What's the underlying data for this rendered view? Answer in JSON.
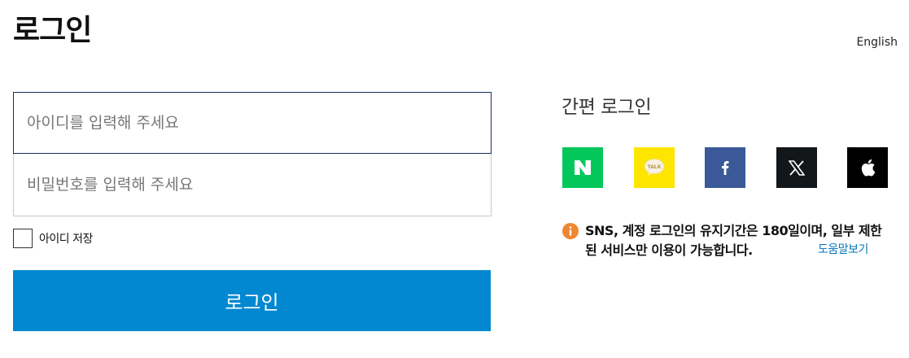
{
  "page": {
    "title": "로그인",
    "language_link": "English"
  },
  "form": {
    "id_placeholder": "아이디를 입력해 주세요",
    "password_placeholder": "비밀번호를 입력해 주세요",
    "save_id_label": "아이디 저장",
    "login_button": "로그인"
  },
  "sns": {
    "title": "간편 로그인",
    "providers": [
      {
        "name": "naver",
        "icon": "naver-icon",
        "color": "#03c75a"
      },
      {
        "name": "kakao",
        "icon": "kakao-talk-icon",
        "color": "#fee500"
      },
      {
        "name": "facebook",
        "icon": "facebook-icon",
        "color": "#3b5998"
      },
      {
        "name": "x",
        "icon": "x-icon",
        "color": "#14171a"
      },
      {
        "name": "apple",
        "icon": "apple-icon",
        "color": "#000000"
      }
    ],
    "notice": "SNS, 계정 로그인의 유지기간은 180일이며, 일부 제한된 서비스만 이용이 가능합니다.",
    "help_link": "도움말보기"
  },
  "colors": {
    "accent": "#0288d1",
    "info": "#f0862e",
    "link": "#0277bd"
  }
}
